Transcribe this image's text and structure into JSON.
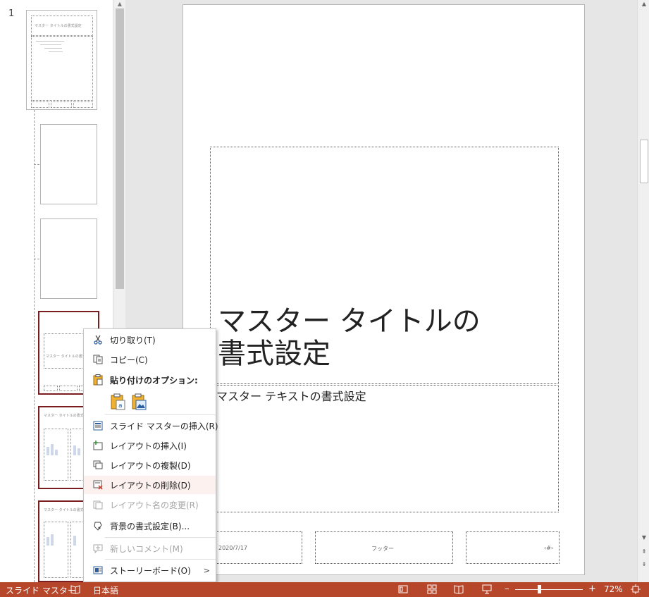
{
  "thumbnail_pane": {
    "slide_number": "1",
    "master_title_small": "マスター タイトルの書式設定",
    "layout_title_small": "マスター タイトルの書式設定"
  },
  "slide": {
    "title_text": "マスター タイトルの\n書式設定",
    "body_text": "マスター テキストの書式設定",
    "date_text": "2020/7/17",
    "footer_text": "フッター",
    "number_text": "‹#›"
  },
  "context_menu": {
    "items": [
      {
        "label": "切り取り(T)",
        "icon": "scissors-icon"
      },
      {
        "label": "コピー(C)",
        "icon": "copy-icon"
      },
      {
        "label": "貼り付けのオプション:",
        "icon": "clipboard-icon"
      },
      {
        "label": "スライド マスターの挿入(R)",
        "icon": "insert-master-icon"
      },
      {
        "label": "レイアウトの挿入(I)",
        "icon": "insert-layout-icon"
      },
      {
        "label": "レイアウトの複製(D)",
        "icon": "duplicate-layout-icon"
      },
      {
        "label": "レイアウトの削除(D)",
        "icon": "delete-layout-icon"
      },
      {
        "label": "レイアウト名の変更(R)",
        "icon": "rename-layout-icon"
      },
      {
        "label": "背景の書式設定(B)...",
        "icon": "format-background-icon"
      },
      {
        "label": "新しいコメント(M)",
        "icon": "comment-icon"
      },
      {
        "label": "ストーリーボード(O)",
        "icon": "storyboard-icon"
      }
    ]
  },
  "status_bar": {
    "mode": "スライド マスター",
    "language": "日本語",
    "zoom": "72%",
    "zoom_level_percent": 72
  },
  "colors": {
    "accent": "#b7472a",
    "selected_border": "#7a1d21"
  }
}
